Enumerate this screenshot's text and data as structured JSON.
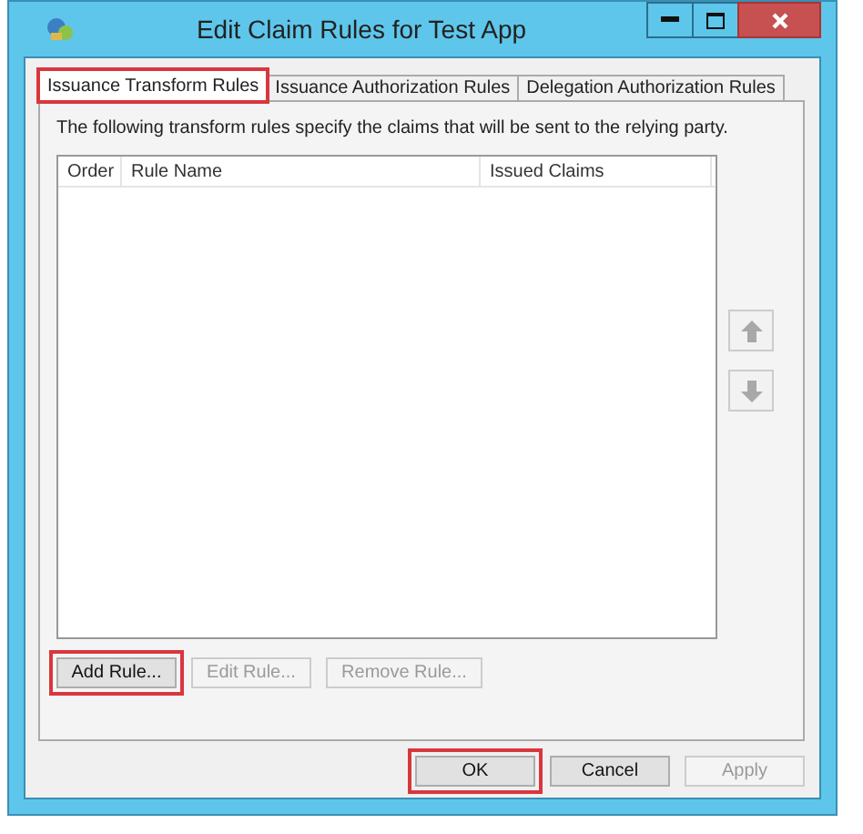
{
  "window": {
    "title": "Edit Claim Rules for Test App",
    "controls": [
      {
        "kind": "minimize"
      },
      {
        "kind": "maximize"
      },
      {
        "kind": "close"
      }
    ]
  },
  "tabs": [
    {
      "label": "Issuance Transform Rules",
      "selected": true,
      "highlighted": true
    },
    {
      "label": "Issuance Authorization Rules",
      "selected": false,
      "highlighted": false
    },
    {
      "label": "Delegation Authorization Rules",
      "selected": false,
      "highlighted": false
    }
  ],
  "description": "The following transform rules specify the claims that will be sent to the relying party.",
  "table": {
    "columns": [
      "Order",
      "Rule Name",
      "Issued Claims"
    ]
  },
  "move_buttons": [
    {
      "kind": "up",
      "disabled": true
    },
    {
      "kind": "down",
      "disabled": true
    }
  ],
  "rule_buttons": [
    {
      "label": "Add Rule...",
      "disabled": false,
      "highlighted": true
    },
    {
      "label": "Edit Rule...",
      "disabled": true,
      "highlighted": false
    },
    {
      "label": "Remove Rule...",
      "disabled": true,
      "highlighted": false
    }
  ],
  "dialog_buttons": [
    {
      "label": "OK",
      "disabled": false,
      "highlighted": true
    },
    {
      "label": "Cancel",
      "disabled": false,
      "highlighted": false
    },
    {
      "label": "Apply",
      "disabled": true,
      "highlighted": false
    }
  ]
}
